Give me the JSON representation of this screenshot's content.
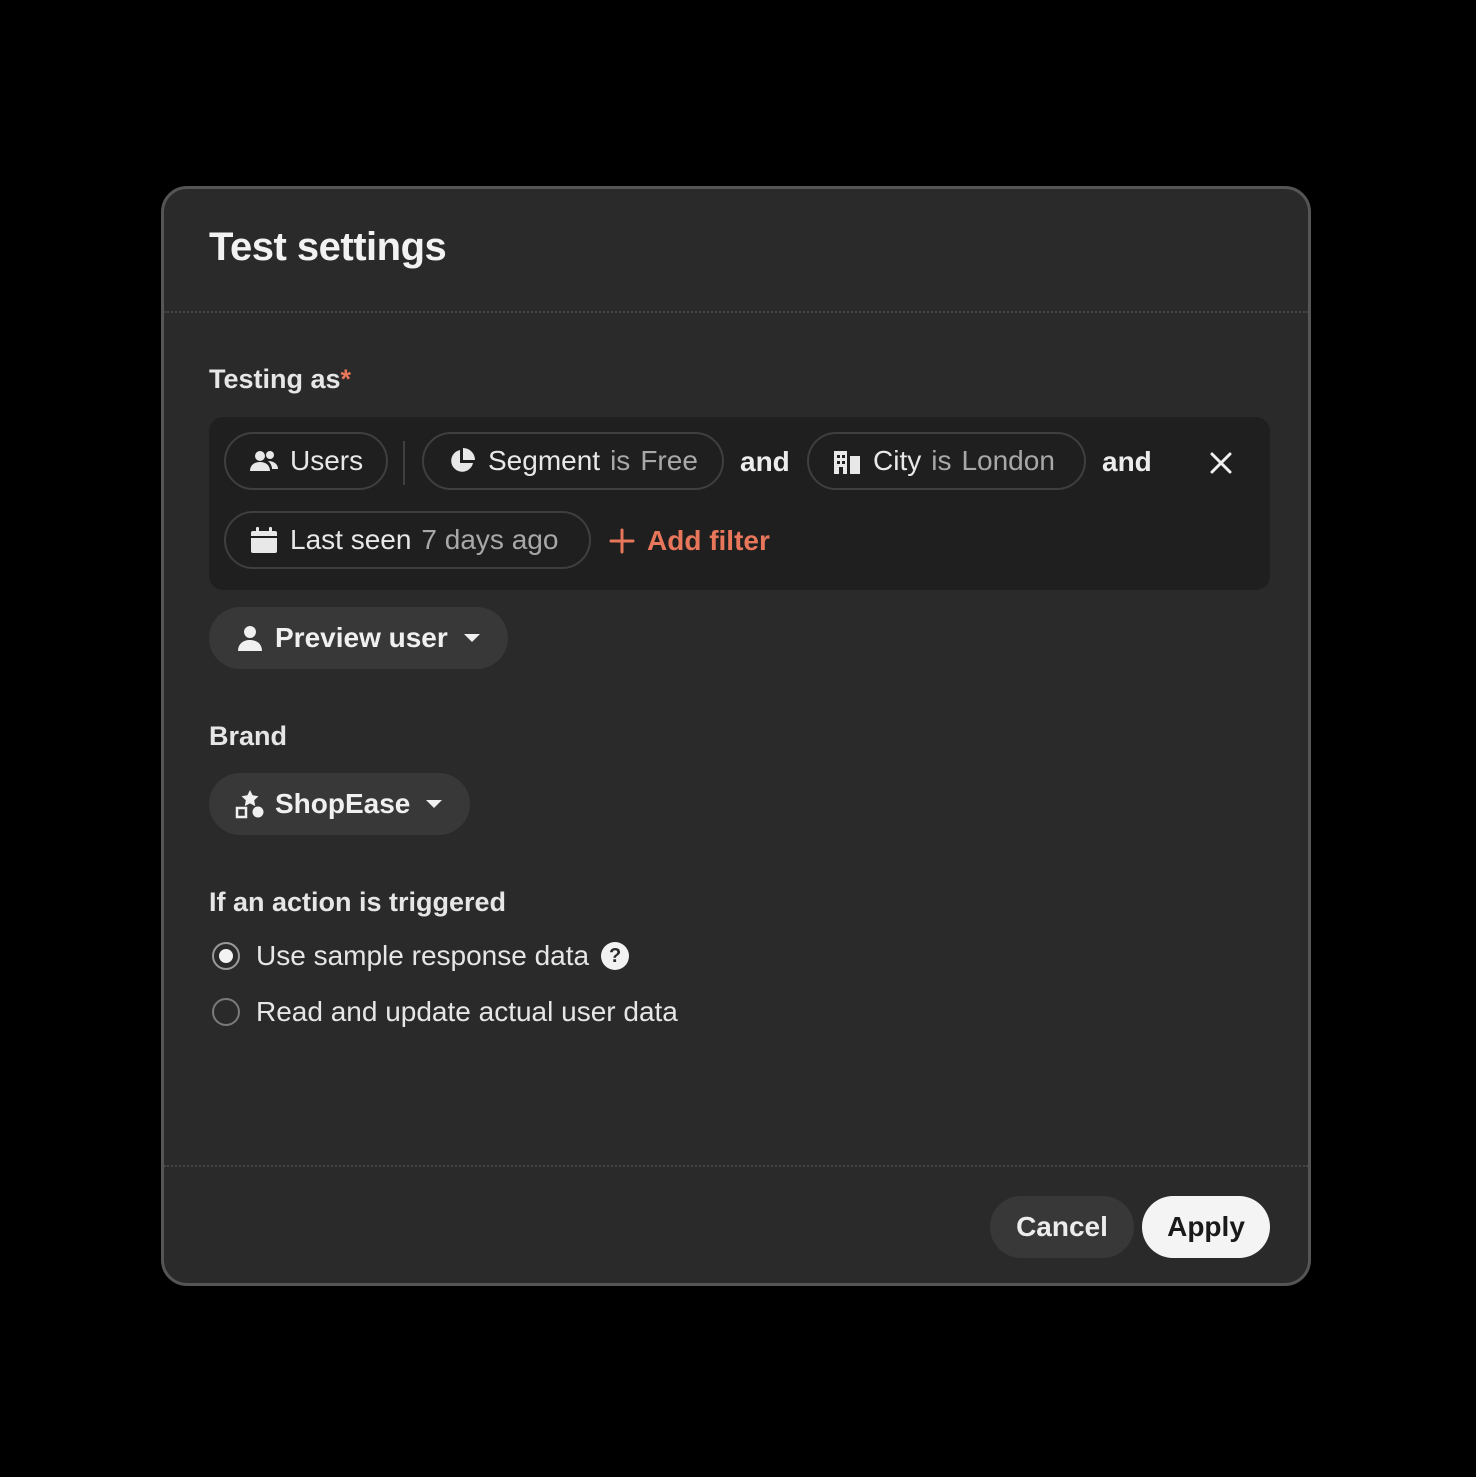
{
  "dialog": {
    "title": "Test settings"
  },
  "testing_as": {
    "label": "Testing as",
    "required_marker": "*",
    "audience_chip": {
      "label": "Users",
      "icon": "users-icon"
    },
    "filters": [
      {
        "field": "Segment",
        "operator": "is",
        "value": "Free",
        "icon": "pie-chart-icon"
      },
      {
        "field": "City",
        "operator": "is",
        "value": "London",
        "icon": "city-icon"
      },
      {
        "field": "Last seen",
        "operator": "",
        "value": "7 days ago",
        "icon": "calendar-icon"
      }
    ],
    "conjunctions": [
      "and",
      "and"
    ],
    "add_filter_label": "Add filter",
    "preview_user_label": "Preview user"
  },
  "brand": {
    "label": "Brand",
    "selected": "ShopEase"
  },
  "action": {
    "label": "If an action is triggered",
    "options": [
      {
        "label": "Use sample response data",
        "checked": true
      },
      {
        "label": "Read and update actual user data",
        "checked": false
      }
    ],
    "help_glyph": "?"
  },
  "footer": {
    "cancel_label": "Cancel",
    "apply_label": "Apply"
  },
  "colors": {
    "accent": "#e8765a",
    "dialog_bg": "#2a2a2a",
    "page_bg": "#000000"
  }
}
